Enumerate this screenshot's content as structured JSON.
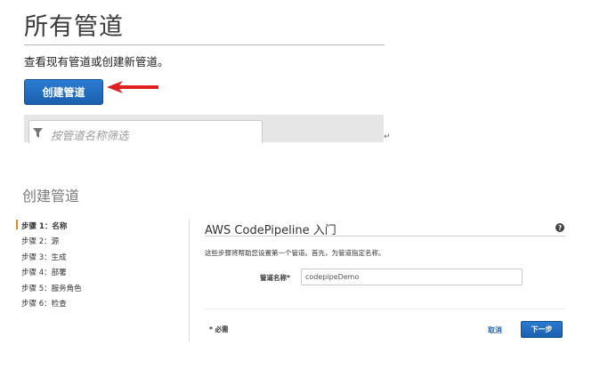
{
  "top": {
    "title": "所有管道",
    "description": "查看现有管道或创建新管道。",
    "create_button": "创建管道",
    "filter_placeholder": "按管道名称筛选"
  },
  "wizard": {
    "title": "创建管道",
    "steps": [
      "步骤 1：名称",
      "步骤 2：源",
      "步骤 3：生成",
      "步骤 4：部署",
      "步骤 5：服务角色",
      "步骤 6：检查"
    ],
    "active_step": 0,
    "panel_title": "AWS CodePipeline 入门",
    "help_glyph": "?",
    "panel_description": "这些步骤将帮助您设置第一个管道。首先，为管道指定名称。",
    "field_label": "管道名称*",
    "field_value": "codepipeDemo",
    "required_note": "* 必需",
    "cancel_label": "取消",
    "next_label": "下一步"
  },
  "colors": {
    "primary_button": "#1f6cc0",
    "arrow": "#e02020",
    "active_step_marker": "#e08a1e",
    "link": "#1a66b8"
  },
  "icons": [
    "arrow-pointer-icon",
    "filter-icon",
    "help-icon"
  ]
}
